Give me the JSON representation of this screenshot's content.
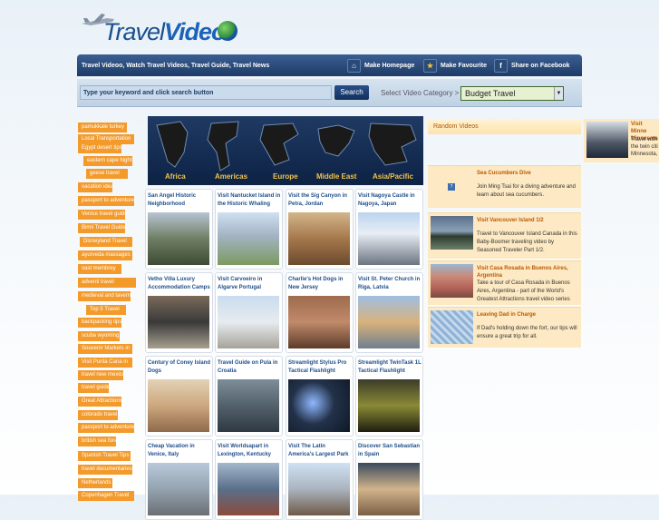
{
  "logo": {
    "part1": "Travel",
    "part2": "Video"
  },
  "navbar": {
    "title": "Travel Videoo, Watch Travel Videos, Travel Guide, Travel News",
    "make_homepage": "Make Homepage",
    "make_favourite": "Make Favourite",
    "share_facebook": "Share on Facebook"
  },
  "search": {
    "placeholder": "Type your keyword and click search button",
    "button": "Search",
    "category_label": "Select Video Category >",
    "category_selected": "Budget Travel"
  },
  "sidebar_tags": [
    "pamukkale turkey",
    "Local Transportation",
    "Egypt desert tips",
    "eastern cape hight",
    "geese travel",
    "vacation ideas",
    "passport to adventure",
    "Venice travel guide",
    "Bimil Travel Guide",
    "Disneyland Travel",
    "ayurveda massages",
    "vast membrey",
    "adventi travel",
    "medieval and taverns",
    "Top 5 Travel",
    "backpacking tips",
    "scuba wyoming",
    "Souvenir Markets in",
    "Visit Punta Cana in",
    "travel new mexico",
    "travel guide",
    "Great Attractions",
    "colorado travel",
    "passport to adventure",
    "british sea fore",
    "Spanish Travel Tips",
    "travel documentaries",
    "Netherlands",
    "Copenhagen Travel"
  ],
  "banner": {
    "regions": [
      "Africa",
      "Americas",
      "Europe",
      "Middle East",
      "Asia/Pacific"
    ]
  },
  "videos": [
    {
      "title": "San Angel Historic Neighborhood"
    },
    {
      "title": "Visit Nantucket Island in the Historic Whaling"
    },
    {
      "title": "Visit the Sig Canyon in Petra, Jordan"
    },
    {
      "title": "Visit Nagoya Castle in Nagoya, Japan"
    },
    {
      "title": "Vetho Villa Luxury Accommodation Camps"
    },
    {
      "title": "Visit Carvoeiro in Algarve Portugal"
    },
    {
      "title": "Charlie's Hot Dogs in New Jersey"
    },
    {
      "title": "Visit St. Peter Church in Riga, Latvia"
    },
    {
      "title": "Century of Coney Island Dogs"
    },
    {
      "title": "Travel Guide on Pula in Croatia"
    },
    {
      "title": "Streamlight Stylus Pro Tactical Flashlight"
    },
    {
      "title": "Streamlight TwinTask 1L Tactical Flashlight"
    },
    {
      "title": "Cheap Vacation in Venice, Italy"
    },
    {
      "title": "Visit Worldsapart in Lexington, Kentucky"
    },
    {
      "title": "Visit The Latin America's Largest Park"
    },
    {
      "title": "Discover San Sebastian in Spain"
    }
  ],
  "random": {
    "heading": "Random Videos",
    "items": [
      {
        "title": "Sea Cucumbers Dive",
        "desc": "Join Ming Tsai for a diving adventure and learn about sea cucumbers."
      },
      {
        "title": "Visit Vancouver Island 1/2",
        "desc": "Travel to Vancouver Island Canada in this Baby-Boomer traveling video by Seasoned Traveler Part 1/2."
      },
      {
        "title": "Visit Casa Rosada in Buenos Aires, Argentina",
        "desc": "Take a tour of Casa Rosada in Buenos Aires, Argentina - part of the World's Greatest Attractions travel video series"
      },
      {
        "title": "Leaving Dad in Charge",
        "desc": "If Dad's holding down the fort, our tips will ensure a great trip for all."
      }
    ],
    "side": {
      "title": "Visit Minne Minnesota",
      "desc": "Travel with the twin citi Minnesota,"
    }
  }
}
